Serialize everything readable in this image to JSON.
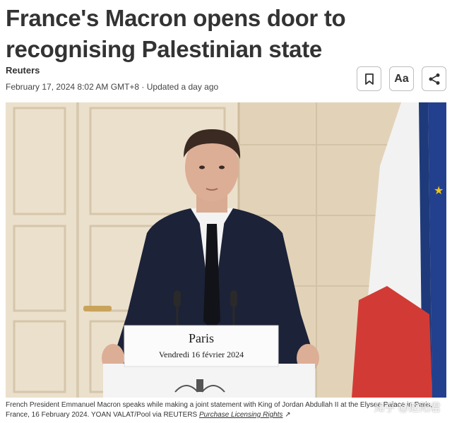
{
  "article": {
    "headline_line1": "France's Macron opens door to",
    "headline_line2": "recognising Palestinian state",
    "byline": "Reuters",
    "dateline": "February 17, 2024 8:02 AM GMT+8 · Updated a day ago"
  },
  "toolbar": {
    "bookmark_icon": "bookmark-icon",
    "text_size_label": "Aa",
    "share_icon": "share-icon"
  },
  "photo": {
    "lectern_title": "Paris",
    "lectern_date": "Vendredi 16 février 2024",
    "caption": "French President Emmanuel Macron speaks while making a joint statement with King of Jordan Abdullah II at the Elysee Palace in Paris, France, 16 February 2024. YOAN VALAT/Pool via REUTERS",
    "licensing_link": "Purchase Licensing Rights"
  },
  "watermark": "知乎 @赵阳君",
  "colors": {
    "flag_blue": "#1f3a7a",
    "flag_white": "#f2f2f2",
    "flag_red": "#d23b35",
    "suit": "#1c2238"
  }
}
